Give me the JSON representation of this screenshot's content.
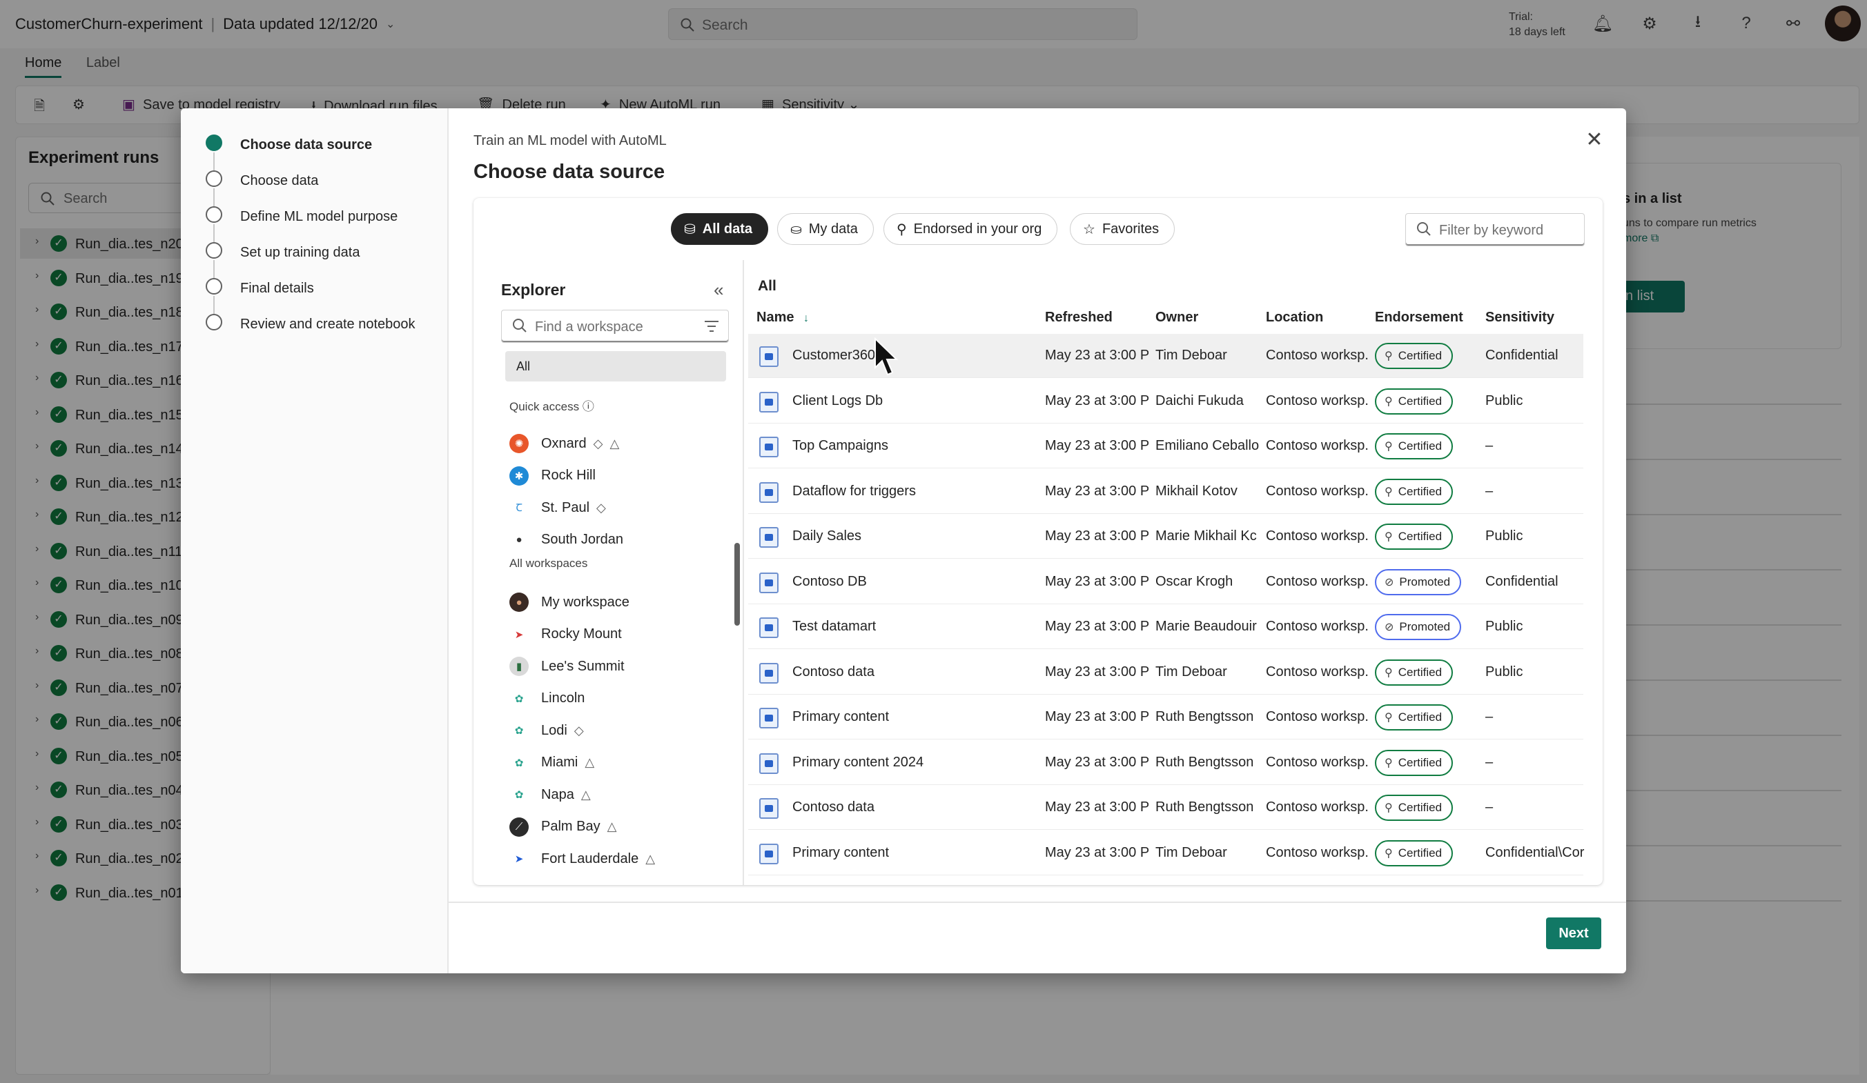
{
  "app": {
    "title": "CustomerChurn-experiment",
    "data_updated": "Data updated 12/12/20",
    "search_placeholder": "Search",
    "trial_line1": "Trial:",
    "trial_line2": "18 days left",
    "tabs": [
      "Home",
      "Label"
    ],
    "toolbar": {
      "save": "Save to model registry",
      "download": "Download run files",
      "delete": "Delete run",
      "new_automl": "New AutoML run",
      "sensitivity": "Sensitivity"
    },
    "experiment_runs": {
      "title": "Experiment runs",
      "search_placeholder": "Search",
      "runs": [
        "Run_dia..tes_n20",
        "Run_dia..tes_n19",
        "Run_dia..tes_n18",
        "Run_dia..tes_n17",
        "Run_dia..tes_n16",
        "Run_dia..tes_n15",
        "Run_dia..tes_n14",
        "Run_dia..tes_n13",
        "Run_dia..tes_n12",
        "Run_dia..tes_n11",
        "Run_dia..tes_n10",
        "Run_dia..tes_n09",
        "Run_dia..tes_n08",
        "Run_dia..tes_n07",
        "Run_dia..tes_n06",
        "Run_dia..tes_n05",
        "Run_dia..tes_n04",
        "Run_dia..tes_n03",
        "Run_dia..tes_n02",
        "Run_dia..tes_n01"
      ]
    },
    "right_panel": {
      "line1": "s in a list",
      "line2": "uns to compare run metrics",
      "line3": "more",
      "button": "n list"
    }
  },
  "dialog": {
    "subtitle": "Train an ML model with AutoML",
    "title": "Choose data source",
    "steps": [
      {
        "label": "Choose data source",
        "active": true
      },
      {
        "label": "Choose data",
        "active": false
      },
      {
        "label": "Define ML model purpose",
        "active": false
      },
      {
        "label": "Set up training data",
        "active": false
      },
      {
        "label": "Final details",
        "active": false
      },
      {
        "label": "Review and create notebook",
        "active": false
      }
    ],
    "filters": [
      "All data",
      "My data",
      "Endorsed in your org",
      "Favorites"
    ],
    "filter_placeholder": "Filter by keyword",
    "explorer": {
      "title": "Explorer",
      "search_placeholder": "Find a workspace",
      "all_label": "All",
      "quick_access_label": "Quick access",
      "quick_access": [
        {
          "name": "Oxnard",
          "color": "#e8562a"
        },
        {
          "name": "Rock Hill",
          "color": "#1f8ad6"
        },
        {
          "name": "St. Paul",
          "color": "#ffffff"
        },
        {
          "name": "South Jordan",
          "color": "#ffffff"
        }
      ],
      "all_workspaces_label": "All workspaces",
      "workspaces": [
        {
          "name": "My workspace",
          "color": "#3a2a24"
        },
        {
          "name": "Rocky Mount",
          "color": "#ffffff"
        },
        {
          "name": "Lee's Summit",
          "color": "#d9d9d9"
        },
        {
          "name": "Lincoln",
          "color": "#ffffff"
        },
        {
          "name": "Lodi",
          "color": "#ffffff"
        },
        {
          "name": "Miami",
          "color": "#ffffff"
        },
        {
          "name": "Napa",
          "color": "#ffffff"
        },
        {
          "name": "Palm Bay",
          "color": "#2b2b2b"
        },
        {
          "name": "Fort Lauderdale",
          "color": "#ffffff"
        }
      ]
    },
    "table": {
      "section_label": "All",
      "columns": [
        "Name",
        "Refreshed",
        "Owner",
        "Location",
        "Endorsement",
        "Sensitivity"
      ],
      "rows": [
        {
          "name": "Customer360",
          "refreshed": "May 23 at 3:00 P",
          "owner": "Tim Deboar",
          "location": "Contoso worksp..",
          "endorsement": "Certified",
          "sensitivity": "Confidential"
        },
        {
          "name": "Client Logs Db",
          "refreshed": "May 23 at 3:00 P",
          "owner": "Daichi Fukuda",
          "location": "Contoso worksp..",
          "endorsement": "Certified",
          "sensitivity": "Public"
        },
        {
          "name": "Top Campaigns",
          "refreshed": "May 23 at 3:00 P",
          "owner": "Emiliano Ceballo",
          "location": "Contoso worksp..",
          "endorsement": "Certified",
          "sensitivity": "–"
        },
        {
          "name": "Dataflow for triggers",
          "refreshed": "May 23 at 3:00 P",
          "owner": "Mikhail Kotov",
          "location": "Contoso worksp..",
          "endorsement": "Certified",
          "sensitivity": "–"
        },
        {
          "name": "Daily Sales",
          "refreshed": "May 23 at 3:00 P",
          "owner": "Marie Mikhail Kc",
          "location": "Contoso worksp..",
          "endorsement": "Certified",
          "sensitivity": "Public"
        },
        {
          "name": "Contoso DB",
          "refreshed": "May 23 at 3:00 P",
          "owner": "Oscar Krogh",
          "location": "Contoso worksp..",
          "endorsement": "Promoted",
          "sensitivity": "Confidential"
        },
        {
          "name": "Test datamart",
          "refreshed": "May 23 at 3:00 P",
          "owner": "Marie Beaudouir",
          "location": "Contoso worksp..",
          "endorsement": "Promoted",
          "sensitivity": "Public"
        },
        {
          "name": "Contoso data",
          "refreshed": "May 23 at 3:00 P",
          "owner": "Tim Deboar",
          "location": "Contoso worksp..",
          "endorsement": "Certified",
          "sensitivity": "Public"
        },
        {
          "name": "Primary content",
          "refreshed": "May 23 at 3:00 P",
          "owner": "Ruth Bengtsson",
          "location": "Contoso worksp..",
          "endorsement": "Certified",
          "sensitivity": "–"
        },
        {
          "name": "Primary content 2024",
          "refreshed": "May 23 at 3:00 P",
          "owner": "Ruth Bengtsson",
          "location": "Contoso worksp..",
          "endorsement": "Certified",
          "sensitivity": "–"
        },
        {
          "name": "Contoso data",
          "refreshed": "May 23 at 3:00 P",
          "owner": "Ruth Bengtsson",
          "location": "Contoso worksp..",
          "endorsement": "Certified",
          "sensitivity": "–"
        },
        {
          "name": "Primary content",
          "refreshed": "May 23 at 3:00 P",
          "owner": "Tim Deboar",
          "location": "Contoso worksp..",
          "endorsement": "Certified",
          "sensitivity": "Confidential\\Cor"
        }
      ]
    },
    "next_label": "Next",
    "colors": {
      "accent": "#117865",
      "certified": "#107c41",
      "promoted": "#4f6bed"
    }
  }
}
